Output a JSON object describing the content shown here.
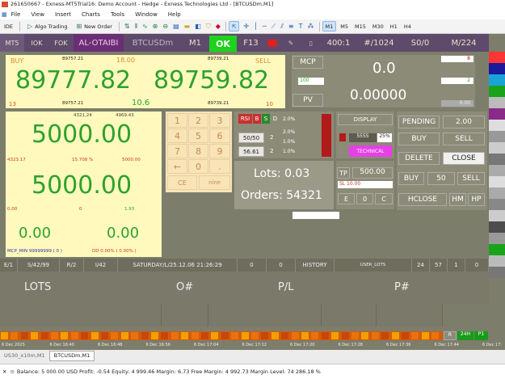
{
  "window": {
    "title": "261650667 - Exness-MT5Trial16: Demo Account - Hedge - Exness Technologies Ltd - [BTCUSDm,M1]"
  },
  "menu": [
    "File",
    "View",
    "Insert",
    "Charts",
    "Tools",
    "Window",
    "Help"
  ],
  "toolbar": {
    "ide": "IDE",
    "algo": "Algo Trading",
    "new_order": "New Order",
    "timeframes": [
      "M1",
      "M5",
      "M15",
      "M30",
      "H1",
      "H4"
    ]
  },
  "panel_top": {
    "mt5": "MT5",
    "iok": "IOK",
    "fok": "FOK",
    "account": "AL-OTAIBI",
    "symbol": "BTCUSDm",
    "tf": "M1",
    "ok": "OK",
    "f13": "F13",
    "ratio": "400:1",
    "lot": "#/1024",
    "so": "S0/0",
    "margin": "M/224"
  },
  "price": {
    "buy_label": "BUY",
    "sell_label": "SELL",
    "buy_small": "89757.21",
    "spread": "18.00",
    "sell_small": "89739.21",
    "buy": "89777.82",
    "sell": "89759.82",
    "left_code": "13",
    "buy_low": "89757.21",
    "mid": "10.6",
    "sell_low": "89739.21",
    "right_code": "10"
  },
  "mcp": {
    "label": "MCP",
    "value": "0.0",
    "badge": "8",
    "v100": "100",
    "badge2": "2",
    "pv": "PV",
    "pv_value": "0.00000",
    "pv_small": "0.00"
  },
  "left_box": {
    "a": "4321.24",
    "b": "4969.43",
    "big1": "5000.00",
    "c1": "4323.17",
    "c2": "15.708 %",
    "c3": "5000.00",
    "big2": "5000.00",
    "d1": "0.00",
    "d2": "0",
    "d3": "1.93",
    "e1": "0.00",
    "e2": "0.00",
    "mcp_min": "MCP_MIN 99999999 ( 0 )",
    "dd": "DD 0.00% ( 0.00% )"
  },
  "keypad": [
    "1",
    "2",
    "3",
    "4",
    "5",
    "6",
    "7",
    "8",
    "9",
    "←",
    "0",
    "."
  ],
  "keypad_ce": "CE",
  "keypad_nine": "nine",
  "ind": {
    "rsi": "RSI",
    "b": "B",
    "s": "S",
    "d": "D",
    "p1": "2.0%",
    "p2": "2.0%",
    "p3": "1.0%",
    "p4": "1.0%",
    "r1": "50/50",
    "r1v": "2",
    "r2": "56.61",
    "r2v": "2"
  },
  "display": {
    "label": "DISPLAY",
    "n1": "5555",
    "n2": "25%",
    "technical": "TECHNICAL"
  },
  "lots": {
    "label": "Lots: 0.03",
    "orders": "Orders: 54321"
  },
  "tp": {
    "label": "TP",
    "value": "500.00",
    "sl": "SL 10.00",
    "e": "E",
    "zero": "0",
    "c": "C"
  },
  "trade": {
    "pending": "PENDING",
    "pv": "2.00",
    "buy": "BUY",
    "sell": "SELL",
    "delete": "DELETE",
    "close": "CLOSE",
    "buy2": "BUY",
    "qty": "50",
    "sell2": "SELL",
    "hclose": "HCLOSE",
    "hm": "HM",
    "hp": "HP"
  },
  "status": {
    "e": "E/1",
    "s": "S/42/99",
    "r": "R/2",
    "i": "I/42",
    "date": "SATURDAY/L/25.12.06 21:26:29",
    "z1": "0",
    "z2": "0",
    "history": "HISTORY",
    "user": "USER_LOTS",
    "n24": "24",
    "n57": "57",
    "n1": "1",
    "n0": "0"
  },
  "orders_head": {
    "lots": "LOTS",
    "onum": "O#",
    "pl": "P/L",
    "pnum": "P#"
  },
  "right_btns": {
    "r": "R",
    "h24": "24H",
    "p1": "P1"
  },
  "axis": [
    "6 Dec 2025",
    "6 Dec 16:40",
    "6 Dec 16:48",
    "6 Dec 16:56",
    "6 Dec 17:04",
    "6 Dec 17:12",
    "6 Dec 17:20",
    "6 Dec 17:28",
    "6 Dec 17:36",
    "6 Dec 17:44",
    "6 Dec 17:"
  ],
  "tabs": [
    "US30_x10m,M1",
    "BTCUSDm,M1"
  ],
  "balance": "Balance: 5 000.00 USD  Profit: -0.54  Equity: 4 999.46  Margin: 6.73  Free Margin: 4 992.73  Margin Level: 74 286.18 %"
}
